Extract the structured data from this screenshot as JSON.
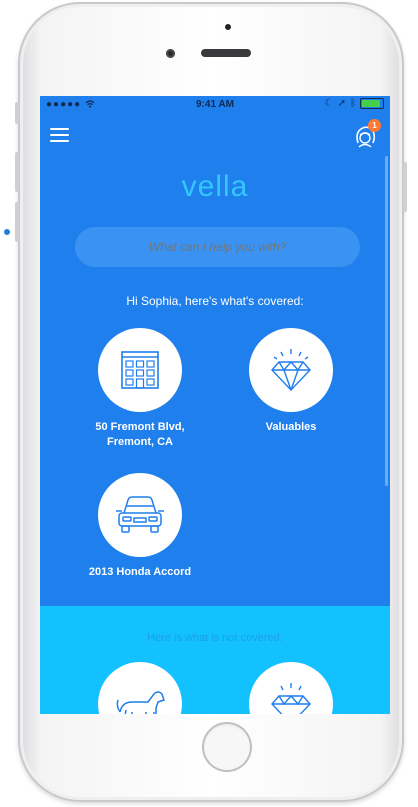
{
  "status_bar": {
    "signal": "●●●●● ",
    "time": "9:41 AM"
  },
  "header": {
    "notification_count": "1"
  },
  "app": {
    "logo": "vella"
  },
  "search": {
    "placeholder": "What can I help you with?"
  },
  "covered": {
    "title": "Hi Sophia, here's what's covered:",
    "items": [
      {
        "label_line1": "50 Fremont Blvd,",
        "label_line2": "Fremont, CA",
        "icon": "building-icon"
      },
      {
        "label_line1": "Valuables",
        "label_line2": "",
        "icon": "diamond-icon"
      },
      {
        "label_line1": "2013 Honda Accord",
        "label_line2": "",
        "icon": "car-icon"
      }
    ]
  },
  "not_covered": {
    "title": "Here is what is not covered:",
    "items": [
      {
        "icon": "dog-icon"
      },
      {
        "icon": "diamond-icon"
      }
    ]
  },
  "colors": {
    "screen_bg": "#1f7fec",
    "accent": "#33c7ff",
    "not_covered_bg": "#14c1ff",
    "badge": "#ff7a2f"
  }
}
